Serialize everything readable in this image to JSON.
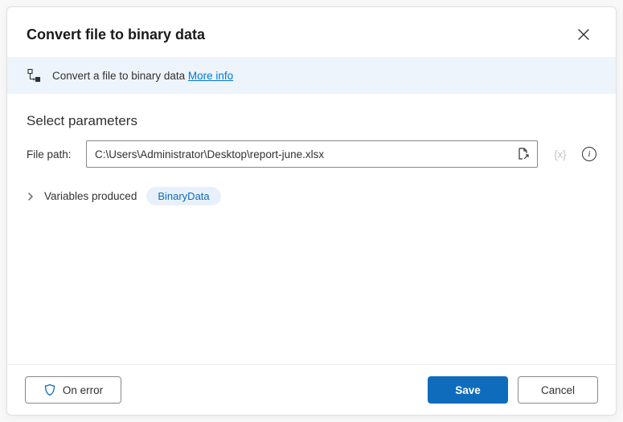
{
  "dialog": {
    "title": "Convert file to binary data"
  },
  "infoBar": {
    "text": "Convert a file to binary data ",
    "linkText": "More info"
  },
  "section": {
    "heading": "Select parameters"
  },
  "filePath": {
    "label": "File path:",
    "value": "C:\\Users\\Administrator\\Desktop\\report-june.xlsx",
    "varToken": "{x}"
  },
  "variablesProduced": {
    "label": "Variables produced",
    "pill": "BinaryData"
  },
  "footer": {
    "onError": "On error",
    "save": "Save",
    "cancel": "Cancel"
  }
}
